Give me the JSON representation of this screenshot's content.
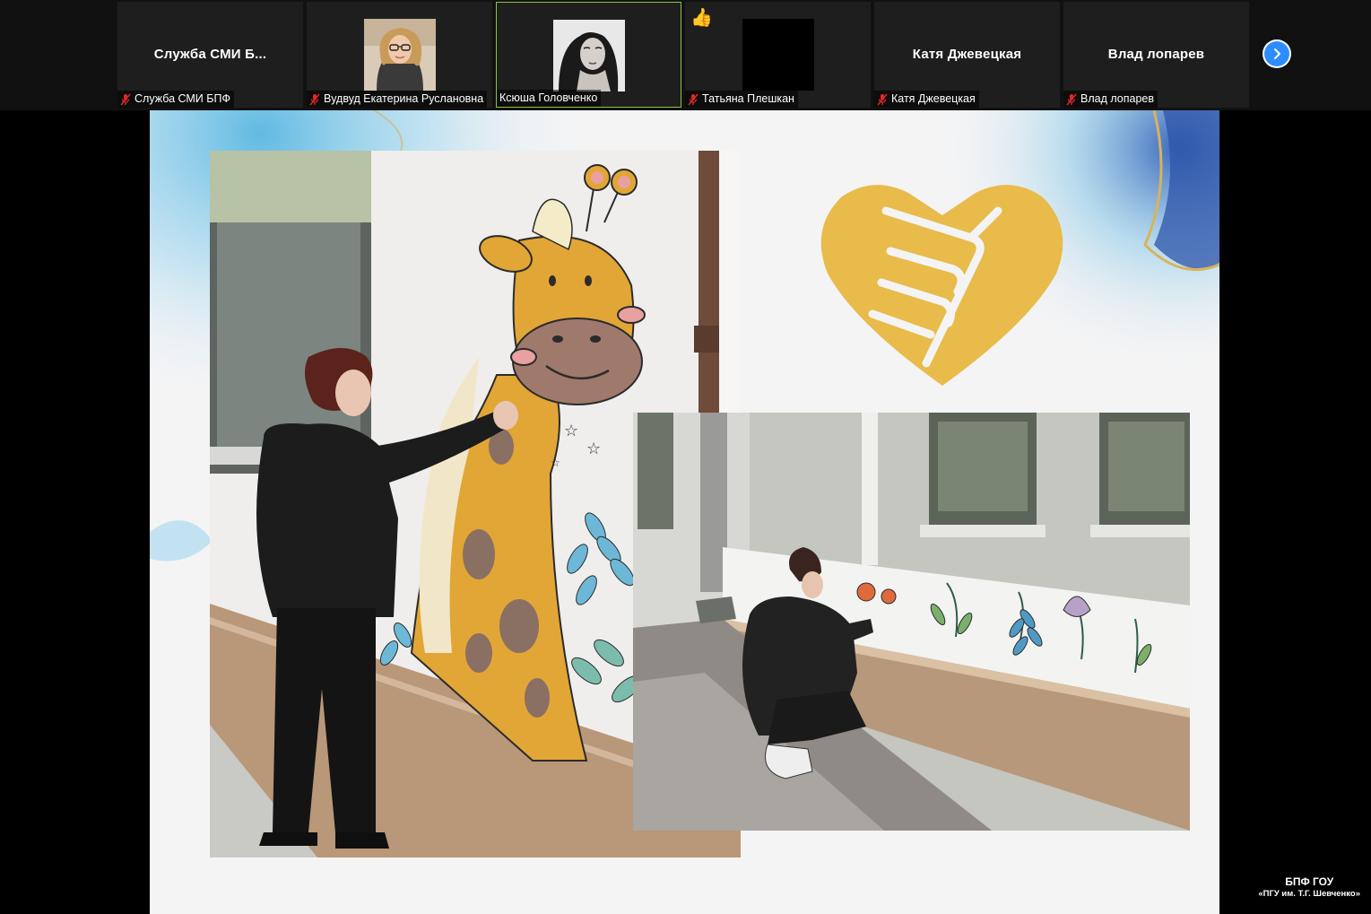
{
  "participants": [
    {
      "display_name": "Служба  СМИ  Б...",
      "label": "Служба СМИ БПФ",
      "muted": true,
      "video": false
    },
    {
      "display_name": "",
      "label": "Вудвуд Екатерина Руслановна",
      "muted": true,
      "video": true
    },
    {
      "display_name": "",
      "label": "Ксюша Головченко",
      "muted": false,
      "video": true,
      "active_speaker": true
    },
    {
      "display_name": "",
      "label": "Татьяна Плешкан",
      "muted": true,
      "video": true,
      "reaction": "👍"
    },
    {
      "display_name": "Катя Джевецкая",
      "label": "Катя Джевецкая",
      "muted": true,
      "video": false
    },
    {
      "display_name": "Влад лопарев",
      "label": "Влад лопарев",
      "muted": true,
      "video": false
    }
  ],
  "reaction_emoji": "👍",
  "next_page_icon": "chevron-right-icon",
  "colors": {
    "active_speaker_border": "#8cc63f",
    "mute_icon": "#e02828",
    "next_button": "#2d8cff",
    "slide_background": "#f4f4f5",
    "logo_gold": "#e8bb4a",
    "watercolor_blue": "#7fc8e8"
  },
  "slide": {
    "logo": "heart-handshake-logo",
    "photos": [
      "giraffe-mural-photo",
      "flower-mural-photo"
    ]
  },
  "watermark": {
    "line1": "БПФ ГОУ",
    "line2": "«ПГУ им. Т.Г. Шевченко»"
  }
}
